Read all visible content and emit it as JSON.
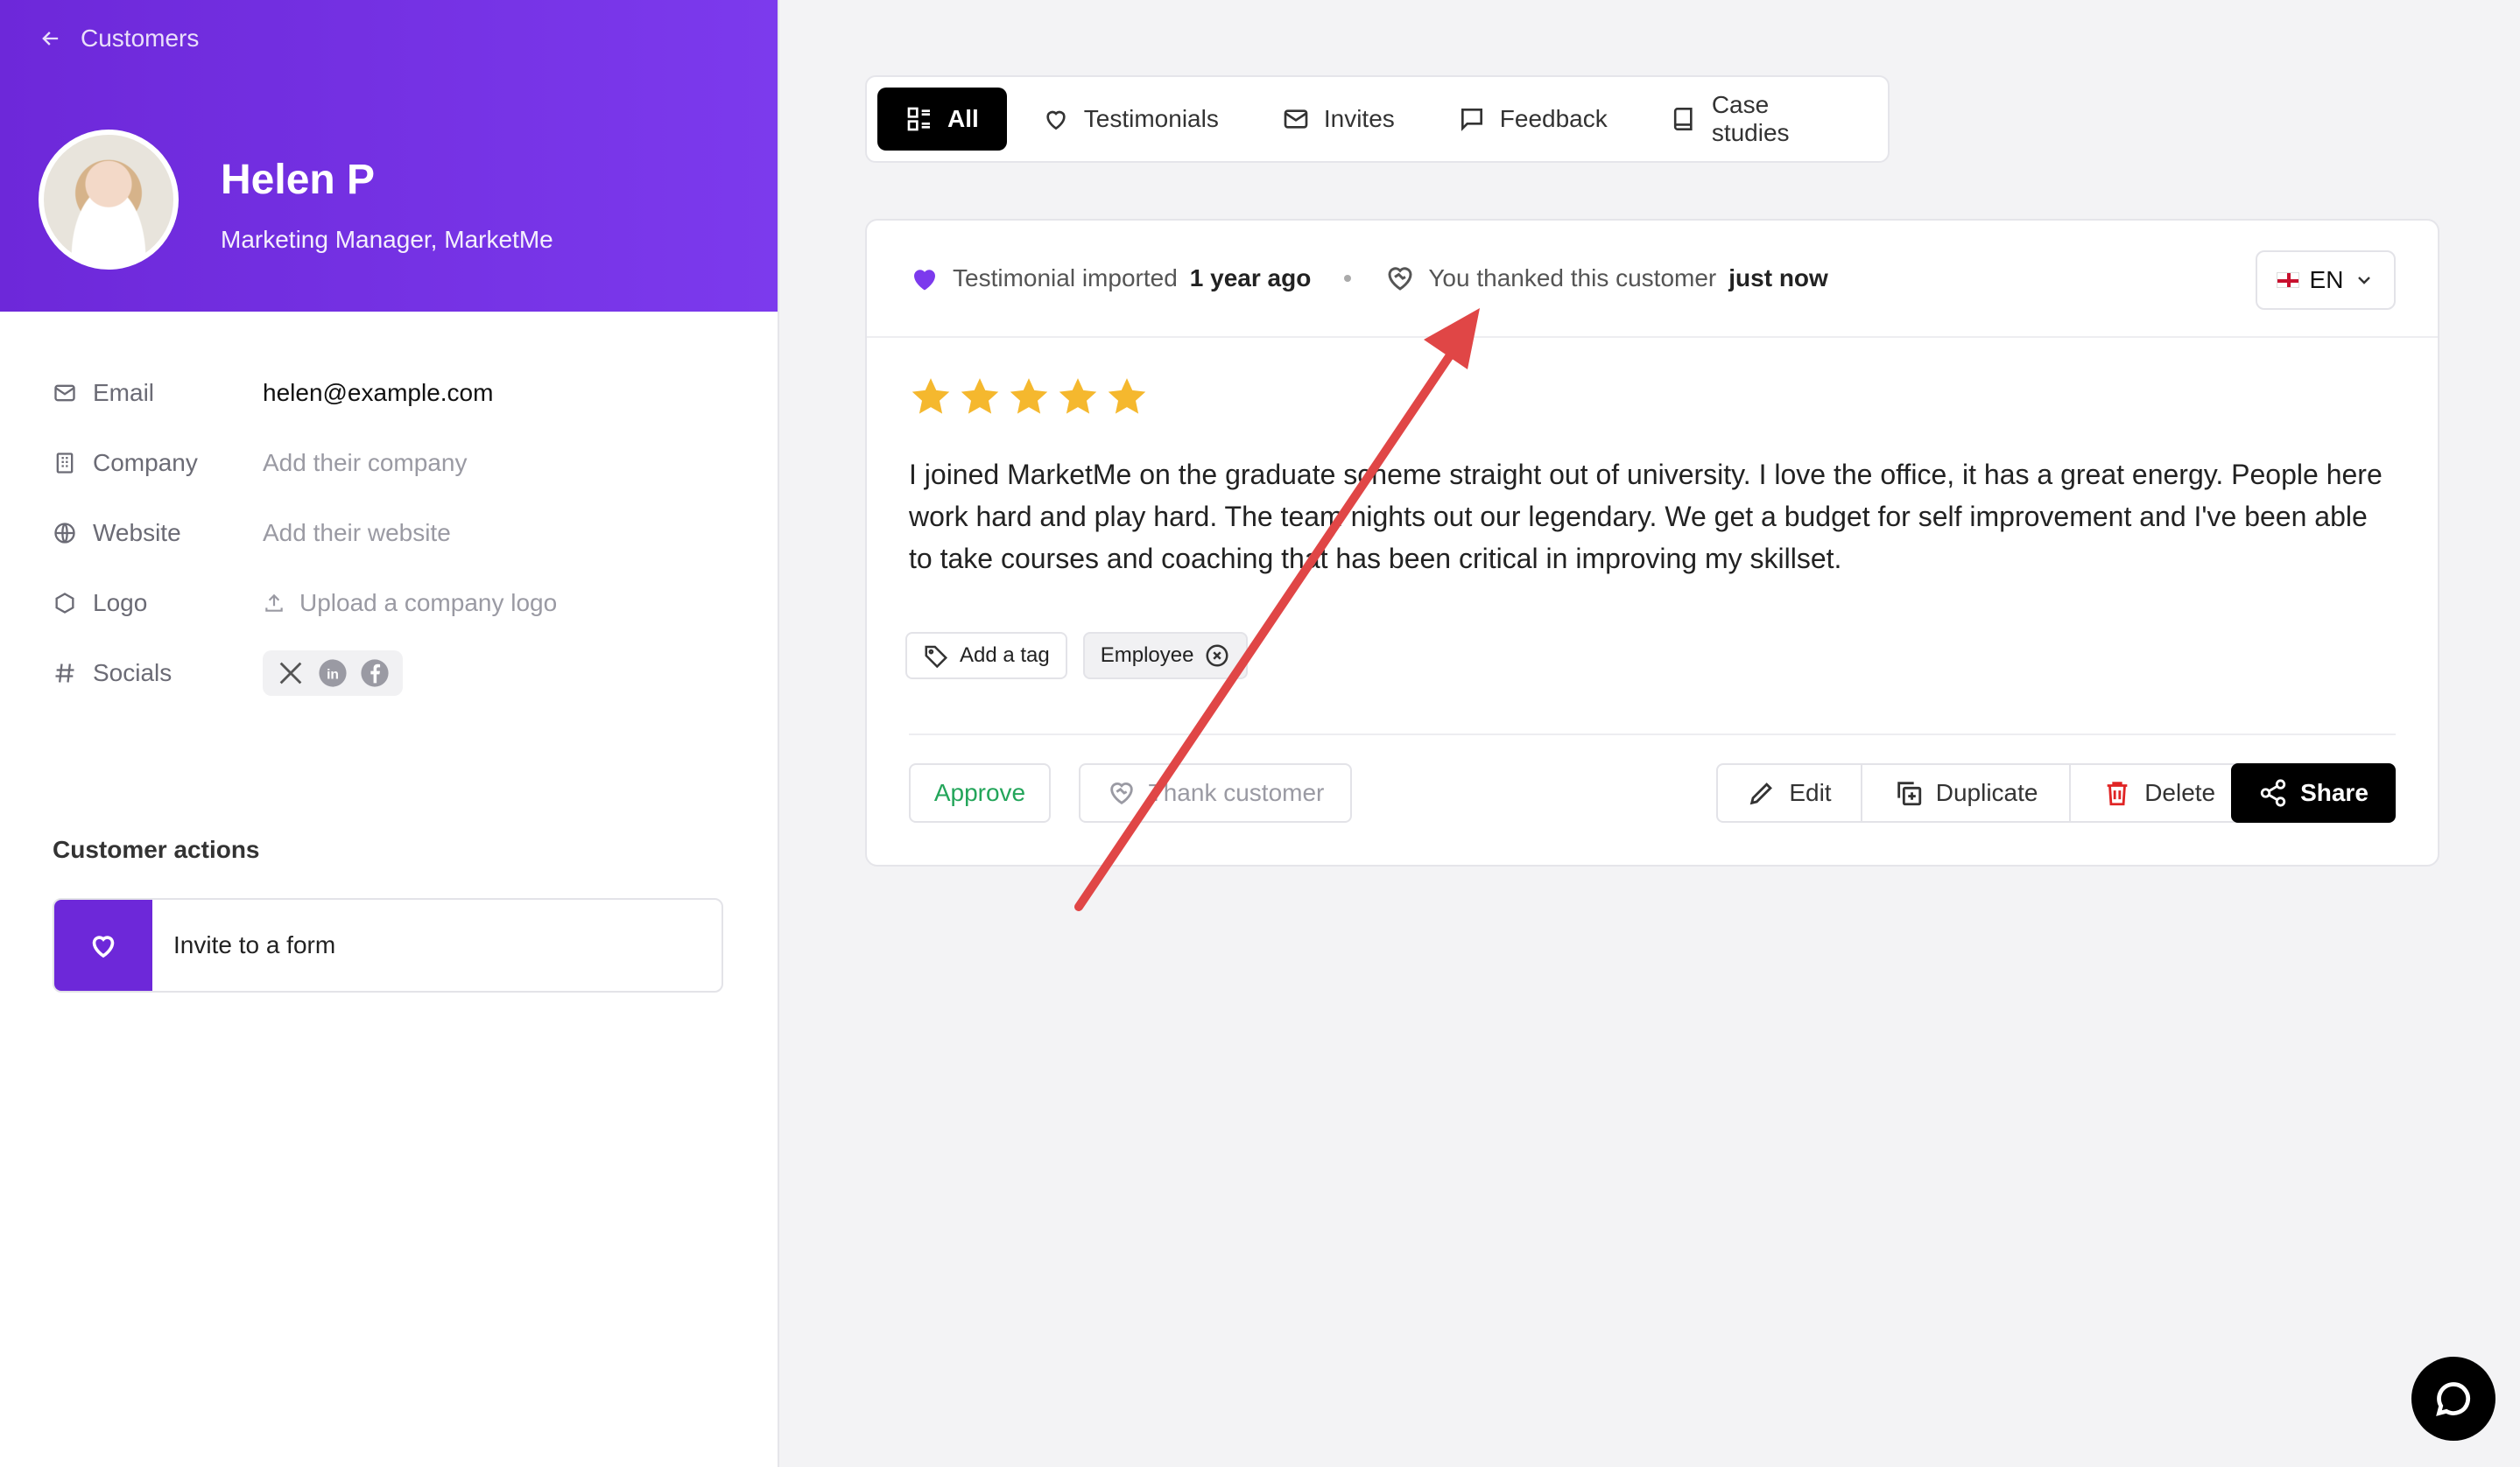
{
  "nav": {
    "back_label": "Customers"
  },
  "profile": {
    "name": "Helen P",
    "role": "Marketing Manager, MarketMe"
  },
  "details": {
    "email_label": "Email",
    "email_value": "helen@example.com",
    "company_label": "Company",
    "company_value": "Add their company",
    "website_label": "Website",
    "website_value": "Add their website",
    "logo_label": "Logo",
    "logo_value": "Upload a company logo",
    "socials_label": "Socials",
    "socials": [
      "x-icon",
      "linkedin-icon",
      "facebook-icon"
    ]
  },
  "customer_actions": {
    "title": "Customer actions",
    "invite_label": "Invite to a form"
  },
  "tabs": [
    {
      "label": "All",
      "icon": "grid-icon",
      "active": true
    },
    {
      "label": "Testimonials",
      "icon": "heart-icon"
    },
    {
      "label": "Invites",
      "icon": "mail-icon"
    },
    {
      "label": "Feedback",
      "icon": "message-icon"
    },
    {
      "label": "Case studies",
      "icon": "book-icon"
    }
  ],
  "testimonial": {
    "imported_label": "Testimonial imported",
    "imported_time": "1 year ago",
    "thanked_label": "You thanked this customer",
    "thanked_time": "just now",
    "language": "EN",
    "rating": 5,
    "text": "I joined MarketMe on the graduate scheme straight out of university. I love the office, it has a great energy. People here work hard and play hard. The team nights out our legendary. We get a budget for self improvement and I've been able to take courses and coaching that has been critical in improving my skillset.",
    "tags": {
      "add_label": "Add a tag",
      "items": [
        "Employee"
      ]
    },
    "actions": {
      "approve": "Approve",
      "thank": "Thank customer",
      "edit": "Edit",
      "duplicate": "Duplicate",
      "delete": "Delete",
      "share": "Share"
    }
  },
  "colors": {
    "brand": "#6d28d9",
    "approve": "#23a55a",
    "delete": "#e02424",
    "annotation_arrow": "#e04646",
    "star": "#f5b82e"
  }
}
